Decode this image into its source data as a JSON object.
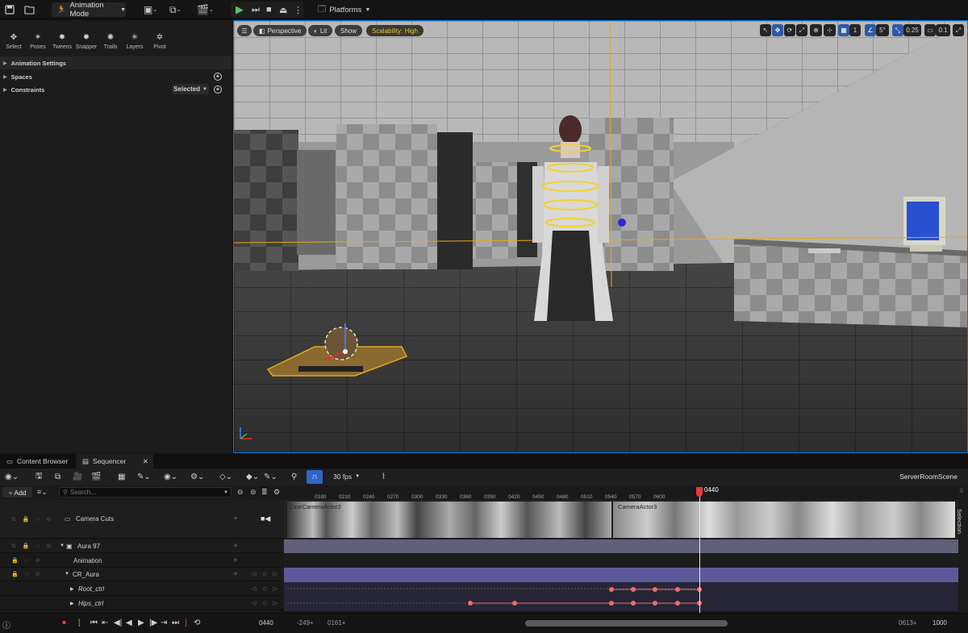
{
  "topbar": {
    "mode_label": "Animation Mode",
    "platforms_label": "Platforms"
  },
  "left_panel": {
    "tools": [
      "Select",
      "Poses",
      "Tweens",
      "Snapper",
      "Trails",
      "Layers",
      "Pivot"
    ],
    "sections": [
      {
        "label": "Animation Settings"
      },
      {
        "label": "Spaces"
      },
      {
        "label": "Constraints"
      }
    ],
    "constraints_dropdown": "Selected"
  },
  "viewport": {
    "menu": "☰",
    "perspective": "Perspective",
    "lit": "Lit",
    "show": "Show",
    "scalability": "Scalability: High",
    "grid_snap": "1",
    "rotation_snap": "5°",
    "scale_snap": "0.25",
    "camera_speed": "0.1"
  },
  "bottom_tabs": {
    "content_browser": "Content Browser",
    "sequencer": "Sequencer"
  },
  "sequencer": {
    "fps": "30 fps",
    "sequence_name": "ServerRoomScene",
    "add_label": "Add",
    "search_placeholder": "Search...",
    "tracks": [
      {
        "name": "Camera Cuts"
      },
      {
        "name": "Aura 97"
      },
      {
        "name": "Animation"
      },
      {
        "name": "CR_Aura"
      },
      {
        "name": "Root_ctrl"
      },
      {
        "name": "Hips_ctrl"
      }
    ],
    "ruler_labels": [
      "0180",
      "0210",
      "0240",
      "0270",
      "0300",
      "0330",
      "0360",
      "0390",
      "0420",
      "0450",
      "0480",
      "0510",
      "0540",
      "0570",
      "0600"
    ],
    "playhead": "0440",
    "camera_clips": [
      "CineCameraActor2",
      "CameraActor3"
    ],
    "selection_tab": "Selection"
  },
  "transport": {
    "current_frame": "0440",
    "view_start": "-249+",
    "play_start": "0161+",
    "play_end": "0613+",
    "view_end": "1000"
  },
  "colors": {
    "accent_blue": "#2f67c9",
    "playhead_red": "#e83a3a",
    "key_color": "#f06a6a",
    "scalability_yellow": "#e8c44a"
  }
}
